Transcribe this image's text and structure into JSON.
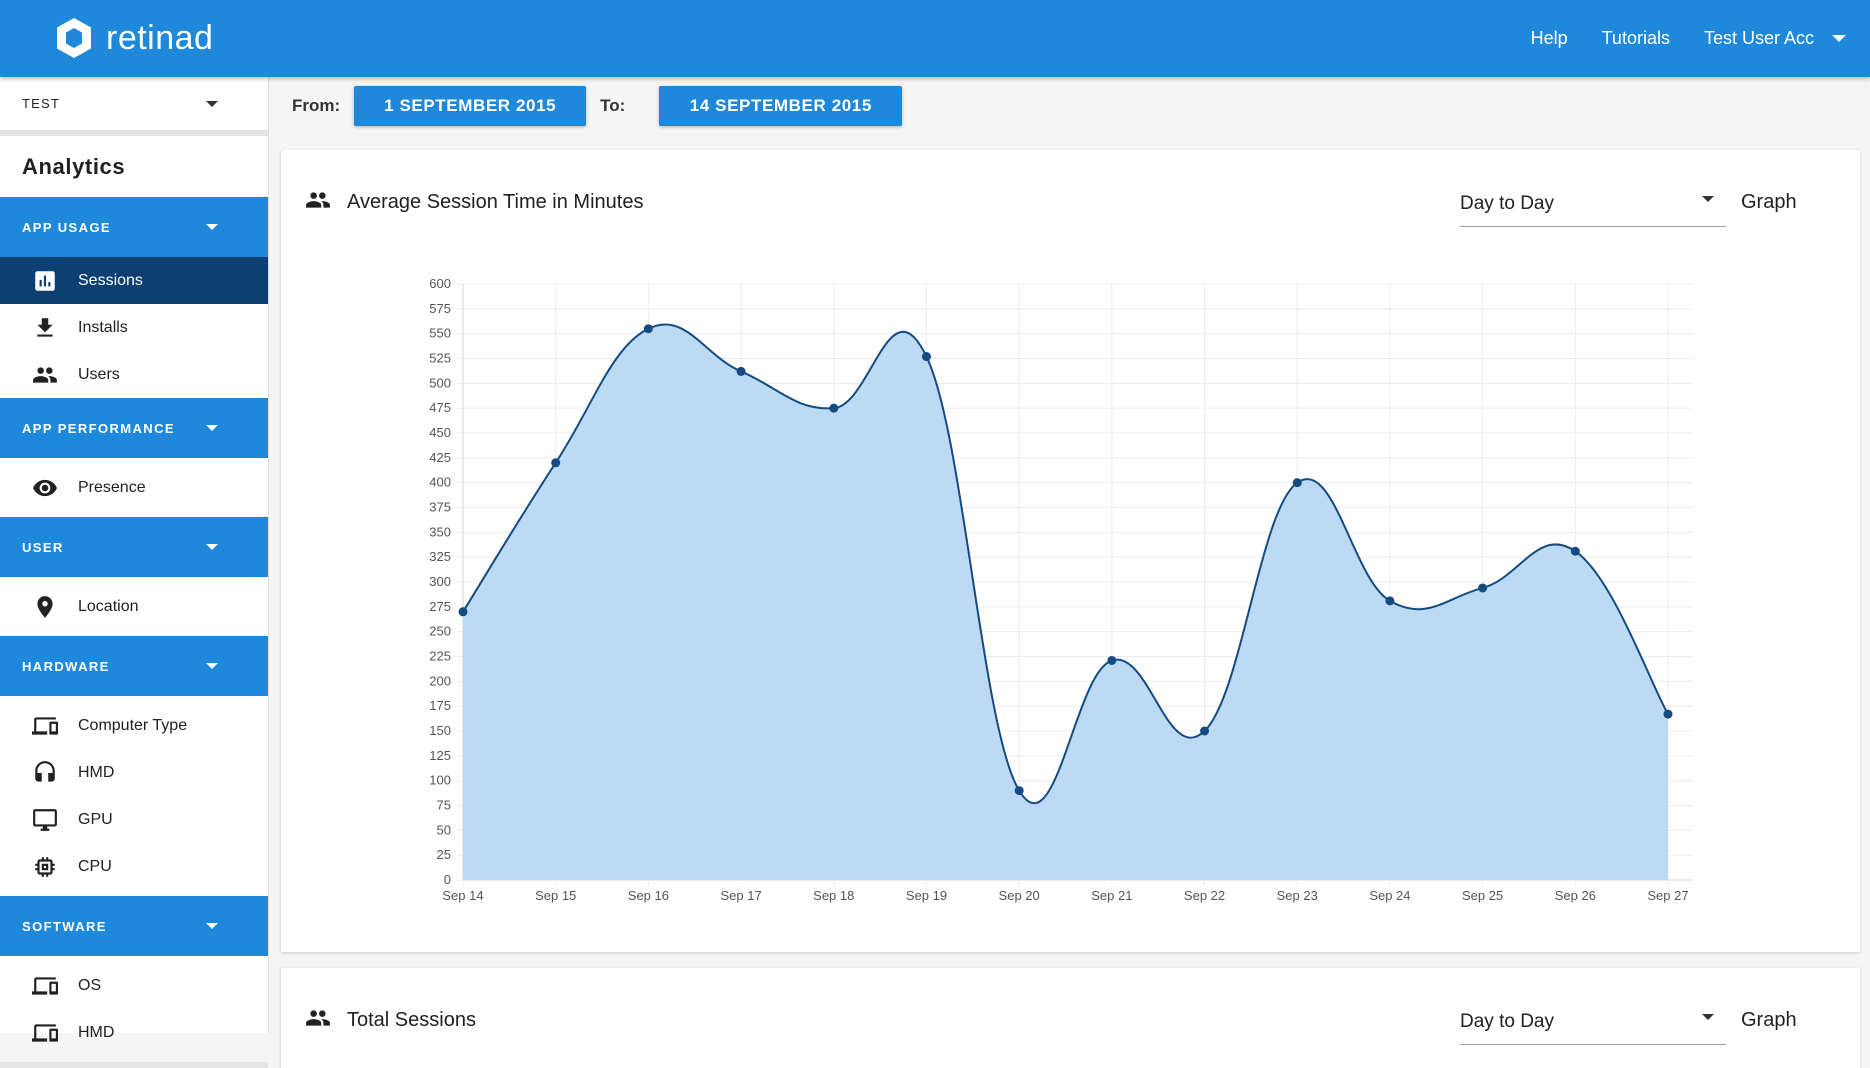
{
  "app": {
    "brand": "retinad",
    "nav": {
      "help": "Help",
      "tutorials": "Tutorials",
      "account": "Test User Acc"
    }
  },
  "sidebar": {
    "project": "TEST",
    "title": "Analytics",
    "sections": {
      "app_usage": {
        "label": "APP USAGE",
        "items": [
          {
            "label": "Sessions",
            "icon": "bar-chart-icon",
            "active": true
          },
          {
            "label": "Installs",
            "icon": "download-icon"
          },
          {
            "label": "Users",
            "icon": "people-icon"
          }
        ]
      },
      "app_performance": {
        "label": "APP PERFORMANCE",
        "items": [
          {
            "label": "Presence",
            "icon": "eye-icon"
          }
        ]
      },
      "user": {
        "label": "USER",
        "items": [
          {
            "label": "Location",
            "icon": "location-pin-icon"
          }
        ]
      },
      "hardware": {
        "label": "HARDWARE",
        "items": [
          {
            "label": "Computer Type",
            "icon": "devices-icon"
          },
          {
            "label": "HMD",
            "icon": "headset-icon"
          },
          {
            "label": "GPU",
            "icon": "monitor-icon"
          },
          {
            "label": "CPU",
            "icon": "chip-icon"
          }
        ]
      },
      "software": {
        "label": "SOFTWARE",
        "items": [
          {
            "label": "OS",
            "icon": "devices-icon"
          },
          {
            "label": "HMD",
            "icon": "devices-icon"
          }
        ]
      }
    }
  },
  "date_range": {
    "from_label": "From:",
    "from_value": "1 SEPTEMBER 2015",
    "to_label": "To:",
    "to_value": "14 SEPTEMBER 2015"
  },
  "cards": [
    {
      "title": "Average Session Time in Minutes",
      "period": "Day to Day",
      "view": "Graph"
    },
    {
      "title": "Total Sessions",
      "period": "Day to Day",
      "view": "Graph"
    }
  ],
  "colors": {
    "primary": "#1e88db",
    "active_item": "#0d3f73",
    "line": "#154b80",
    "area_fill": "#b9d8f3"
  },
  "chart_data": {
    "type": "area",
    "title": "",
    "xlabel": "",
    "ylabel": "",
    "categories": [
      "Sep 14",
      "Sep 15",
      "Sep 16",
      "Sep 17",
      "Sep 18",
      "Sep 19",
      "Sep 20",
      "Sep 21",
      "Sep 22",
      "Sep 23",
      "Sep 24",
      "Sep 25",
      "Sep 26",
      "Sep 27"
    ],
    "values": [
      270,
      420,
      555,
      512,
      475,
      527,
      90,
      221,
      150,
      400,
      281,
      294,
      331,
      167
    ],
    "ylim": [
      0,
      600
    ],
    "yticks": [
      0,
      25,
      50,
      75,
      100,
      125,
      150,
      175,
      200,
      225,
      250,
      275,
      300,
      325,
      350,
      375,
      400,
      425,
      450,
      475,
      500,
      525,
      550,
      575,
      600
    ],
    "grid": true,
    "legend": "none",
    "smooth": true
  }
}
